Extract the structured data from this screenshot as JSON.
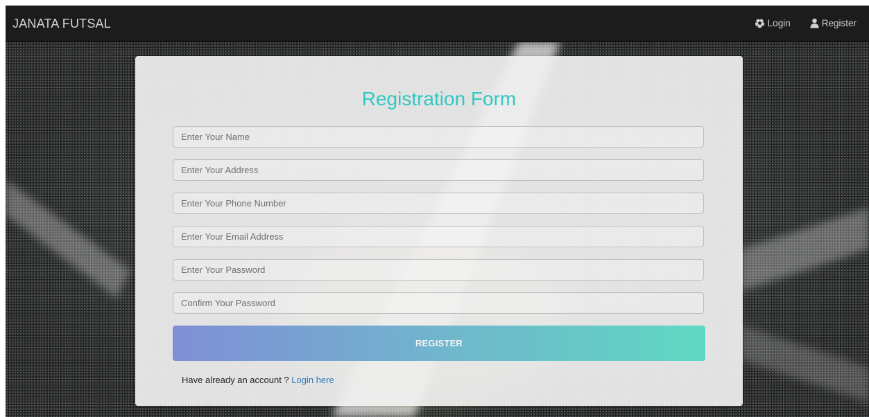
{
  "navbar": {
    "brand": "JANATA FUTSAL",
    "links": [
      {
        "label": "Login",
        "icon": "soccer-ball-icon"
      },
      {
        "label": "Register",
        "icon": "user-icon"
      }
    ]
  },
  "form": {
    "title": "Registration Form",
    "fields": [
      {
        "placeholder": "Enter Your Name",
        "value": ""
      },
      {
        "placeholder": "Enter Your Address",
        "value": ""
      },
      {
        "placeholder": "Enter Your Phone Number",
        "value": ""
      },
      {
        "placeholder": "Enter Your Email Address",
        "value": ""
      },
      {
        "placeholder": "Enter Your Password",
        "value": ""
      },
      {
        "placeholder": "Confirm Your Password",
        "value": ""
      }
    ],
    "submit_label": "REGISTER",
    "footer_text": "Have already an account ? ",
    "footer_link": "Login here"
  },
  "colors": {
    "title": "#2fc9c1",
    "navbar_bg": "#1c1c1c",
    "button_gradient_start": "#7f8fd6",
    "button_gradient_end": "#5fd8c2",
    "link": "#2c7cbf"
  }
}
